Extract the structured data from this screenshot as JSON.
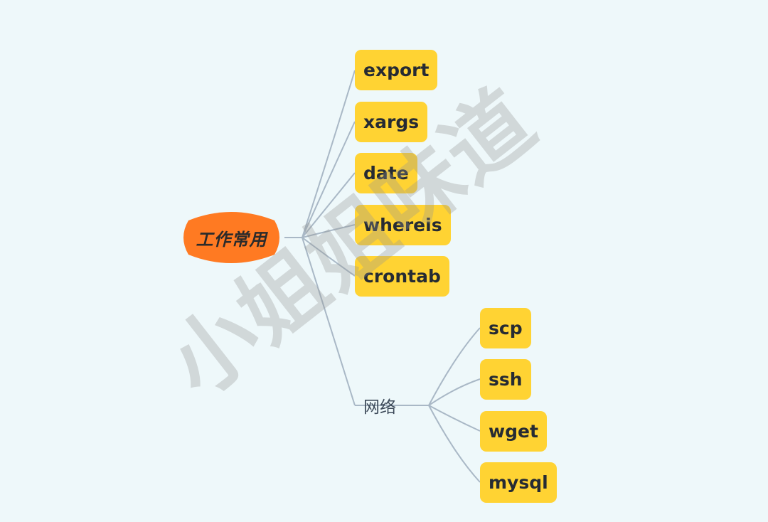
{
  "colors": {
    "background": "#eef8fa",
    "root_fill": "#ff7a22",
    "node_fill": "#ffd333",
    "edge": "#a9b8c6",
    "node_text": "#262b33"
  },
  "root": {
    "label": "工作常用"
  },
  "children": [
    {
      "label": "export"
    },
    {
      "label": "xargs"
    },
    {
      "label": "date"
    },
    {
      "label": "whereis"
    },
    {
      "label": "crontab"
    }
  ],
  "group": {
    "label": "网络",
    "children": [
      {
        "label": "scp"
      },
      {
        "label": "ssh"
      },
      {
        "label": "wget"
      },
      {
        "label": "mysql"
      }
    ]
  },
  "watermark": {
    "text": "小姐姐味道"
  }
}
